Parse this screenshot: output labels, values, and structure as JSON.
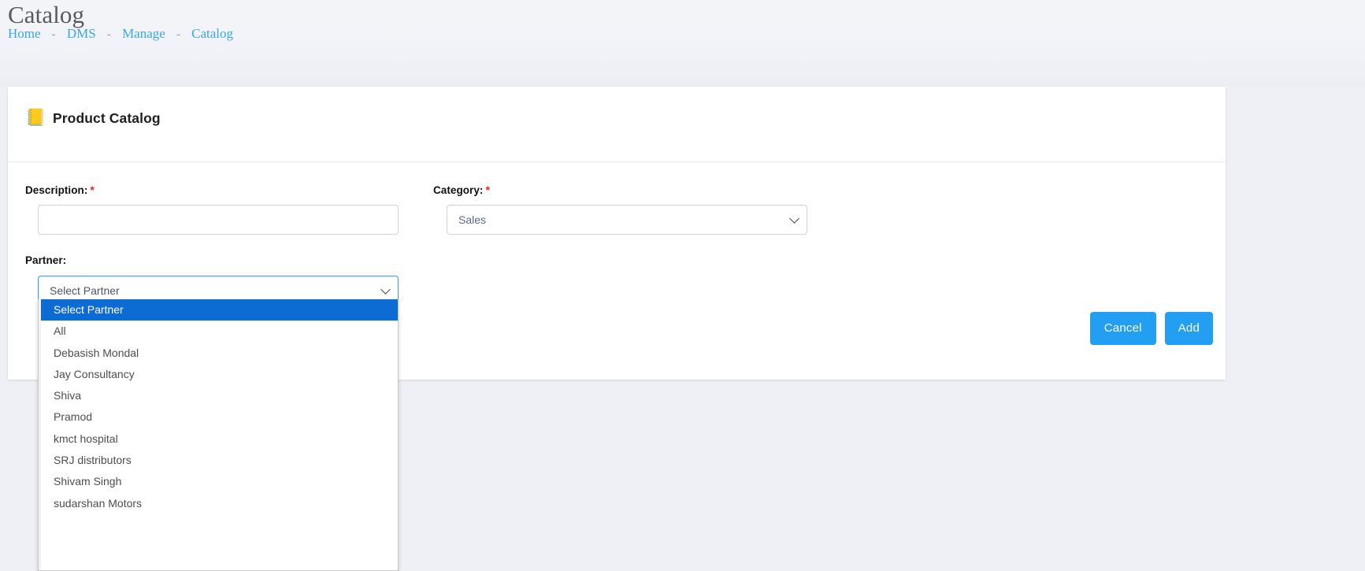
{
  "header": {
    "title": "Catalog",
    "breadcrumb": {
      "separator": "-",
      "items": [
        {
          "label": "Home"
        },
        {
          "label": "DMS"
        },
        {
          "label": "Manage"
        },
        {
          "label": "Catalog"
        }
      ]
    }
  },
  "card": {
    "icon": "notebook-icon",
    "icon_glyph": "📒",
    "title": "Product Catalog"
  },
  "form": {
    "description": {
      "label": "Description:",
      "required_marker": "*",
      "value": "",
      "placeholder": ""
    },
    "category": {
      "label": "Category:",
      "required_marker": "*",
      "selected": "Sales"
    },
    "partner": {
      "label": "Partner:",
      "selected": "Select Partner",
      "expanded": true,
      "options": [
        "Select Partner",
        "All",
        "Debasish Mondal",
        "Jay Consultancy",
        "Shiva",
        "Pramod",
        "kmct hospital",
        "SRJ distributors",
        "Shivam Singh",
        "sudarshan Motors"
      ]
    }
  },
  "actions": {
    "cancel_label": "Cancel",
    "add_label": "Add"
  },
  "colors": {
    "accent_blue": "#229ef2",
    "breadcrumb_link": "#3ba7ea",
    "option_highlight": "#0d6bd4",
    "required_red": "#f02020",
    "page_background": "#eef0f5",
    "focus_border": "#2d9cf0"
  }
}
